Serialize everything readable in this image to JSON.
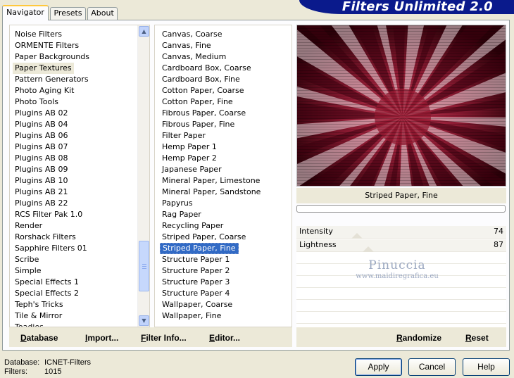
{
  "tabs": [
    {
      "label": "Navigator",
      "active": true
    },
    {
      "label": "Presets",
      "active": false
    },
    {
      "label": "About",
      "active": false
    }
  ],
  "title": "Filters Unlimited 2.0",
  "categories": [
    "Noise Filters",
    "ORMENTE Filters",
    "Paper Backgrounds",
    "Paper Textures",
    "Pattern Generators",
    "Photo Aging Kit",
    "Photo Tools",
    "Plugins AB 02",
    "Plugins AB 04",
    "Plugins AB 06",
    "Plugins AB 07",
    "Plugins AB 08",
    "Plugins AB 09",
    "Plugins AB 10",
    "Plugins AB 21",
    "Plugins AB 22",
    "RCS Filter Pak 1.0",
    "Render",
    "Rorshack Filters",
    "Sapphire Filters 01",
    "Scribe",
    "Simple",
    "Special Effects 1",
    "Special Effects 2",
    "Teph's Tricks",
    "Tile & Mirror",
    "Toadies"
  ],
  "selected_category": "Paper Textures",
  "filters": [
    "Canvas, Coarse",
    "Canvas, Fine",
    "Canvas, Medium",
    "Cardboard Box, Coarse",
    "Cardboard Box, Fine",
    "Cotton Paper, Coarse",
    "Cotton Paper, Fine",
    "Fibrous Paper, Coarse",
    "Fibrous Paper, Fine",
    "Filter Paper",
    "Hemp Paper 1",
    "Hemp Paper 2",
    "Japanese Paper",
    "Mineral Paper, Limestone",
    "Mineral Paper, Sandstone",
    "Papyrus",
    "Rag Paper",
    "Recycling Paper",
    "Striped Paper, Coarse",
    "Striped Paper, Fine",
    "Structure Paper 1",
    "Structure Paper 2",
    "Structure Paper 3",
    "Structure Paper 4",
    "Wallpaper, Coarse",
    "Wallpaper, Fine"
  ],
  "selected_filter": "Striped Paper, Fine",
  "preview_name": "Striped Paper, Fine",
  "sliders": [
    {
      "label": "Intensity",
      "value": "74",
      "fraction": 0.29
    },
    {
      "label": "Lightness",
      "value": "87",
      "fraction": 0.34
    }
  ],
  "watermark": {
    "line1": "Pinuccia",
    "line2": "www.maidiregrafica.eu"
  },
  "left_buttons": {
    "database": "Database",
    "import": "Import...",
    "filter_info": "Filter Info...",
    "editor": "Editor..."
  },
  "right_buttons": {
    "randomize": "Randomize",
    "reset": "Reset"
  },
  "status": {
    "database_label": "Database:",
    "database_value": "ICNET-Filters",
    "filters_label": "Filters:",
    "filters_value": "1015"
  },
  "dialog_buttons": {
    "apply": "Apply",
    "cancel": "Cancel",
    "help": "Help"
  },
  "colors": {
    "banner": "#0a1a8c",
    "selection": "#316ac5",
    "preview_main": "#8c1a32"
  }
}
